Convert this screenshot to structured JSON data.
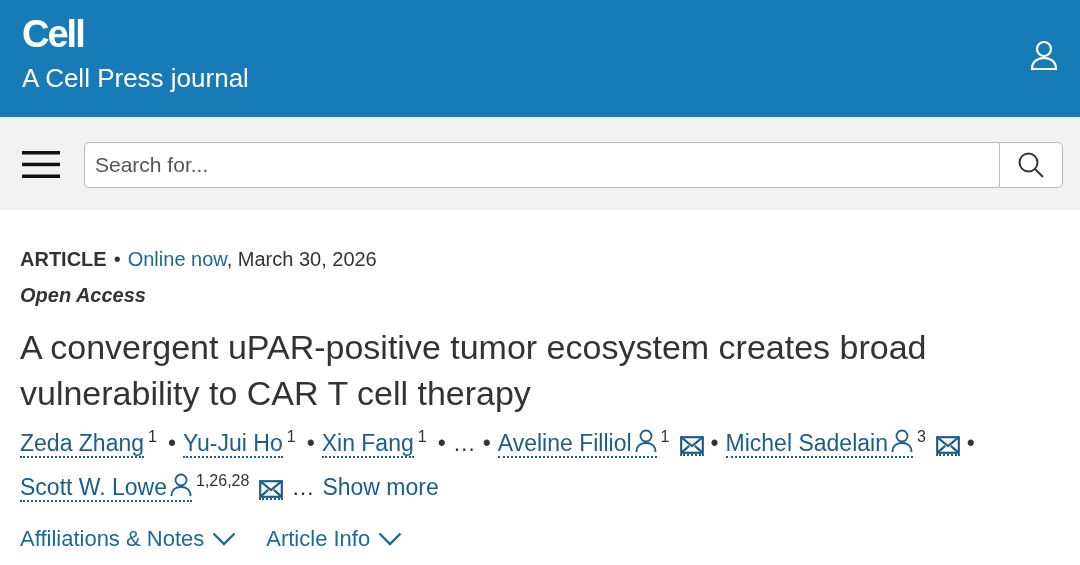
{
  "header": {
    "logo": "Cell",
    "tagline": "A Cell Press journal"
  },
  "search": {
    "placeholder": "Search for..."
  },
  "article": {
    "type": "ARTICLE",
    "meta_separator": "•",
    "status_link": "Online now",
    "date": ", March 30, 2026",
    "access": "Open Access",
    "title": "A convergent uPAR-positive tumor ecosystem creates broad vulnerability to CAR T cell therapy",
    "author_separator": "•",
    "authors": [
      {
        "kind": "author",
        "name": "Zeda Zhang",
        "corresponding": false,
        "sup": "1",
        "email": false
      },
      {
        "kind": "author",
        "name": "Yu-Jui Ho",
        "corresponding": false,
        "sup": "1",
        "email": false
      },
      {
        "kind": "author",
        "name": "Xin Fang",
        "corresponding": false,
        "sup": "1",
        "email": false
      },
      {
        "kind": "ellipsis",
        "text": "…"
      },
      {
        "kind": "author",
        "name": "Aveline Filliol",
        "corresponding": true,
        "sup": "1",
        "email": true
      },
      {
        "kind": "author",
        "name": "Michel Sadelain",
        "corresponding": true,
        "sup": "3",
        "email": true
      },
      {
        "kind": "author",
        "name": "Scott W. Lowe",
        "corresponding": true,
        "sup": "1,26,28",
        "email": true
      }
    ],
    "more_ellipsis": "…",
    "show_more": "Show more",
    "sections": [
      {
        "label": "Affiliations & Notes",
        "expanded": false
      },
      {
        "label": "Article Info",
        "expanded": false
      }
    ]
  }
}
